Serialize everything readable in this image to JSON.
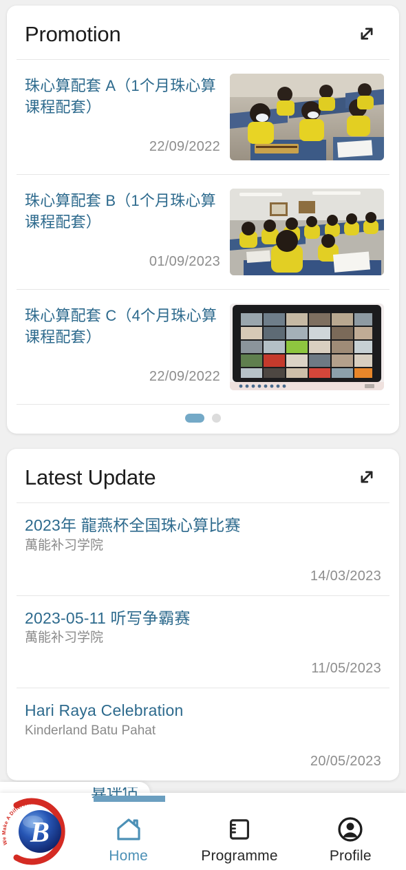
{
  "promotion": {
    "title": "Promotion",
    "expand_icon": "expand-diagonal-icon",
    "items": [
      {
        "title": "珠心算配套 A（1个月珠心算课程配套）",
        "date": "22/09/2022",
        "thumb": "classroom-students-abacus-photo"
      },
      {
        "title": "珠心算配套 B（1个月珠心算课程配套）",
        "date": "01/09/2023",
        "thumb": "classroom-students-writing-photo"
      },
      {
        "title": "珠心算配套 C（4个月珠心算课程配套）",
        "date": "22/09/2022",
        "thumb": "online-video-call-grid-photo"
      }
    ],
    "pagination": {
      "total": 2,
      "active": 1
    }
  },
  "latest_update": {
    "title": "Latest Update",
    "expand_icon": "expand-diagonal-icon",
    "items": [
      {
        "title": "2023年 龍燕杯全国珠心算比赛",
        "subtitle": "萬能补习学院",
        "date": "14/03/2023"
      },
      {
        "title": "2023-05-11 听写争霸赛",
        "subtitle": "萬能补习学院",
        "date": "11/05/2023"
      },
      {
        "title": "Hari Raya Celebration",
        "subtitle": "Kinderland Batu Pahat",
        "date": "20/05/2023"
      }
    ]
  },
  "bottom_nav": {
    "logo": {
      "letter": "B",
      "tagline": "We Make A Difference"
    },
    "clipped_label": "算评估",
    "items": [
      {
        "label": "Home",
        "icon": "home-icon",
        "active": true
      },
      {
        "label": "Programme",
        "icon": "notebook-icon",
        "active": false
      },
      {
        "label": "Profile",
        "icon": "account-circle-icon",
        "active": false
      }
    ]
  },
  "colors": {
    "background": "#f0f0f0",
    "card": "#ffffff",
    "link": "#2d6a8d",
    "muted": "#8d8d8d",
    "accent": "#74a9c7",
    "heading": "#1c1c1c",
    "logo_blue": "#1a3f8f",
    "logo_red": "#d42b23"
  }
}
